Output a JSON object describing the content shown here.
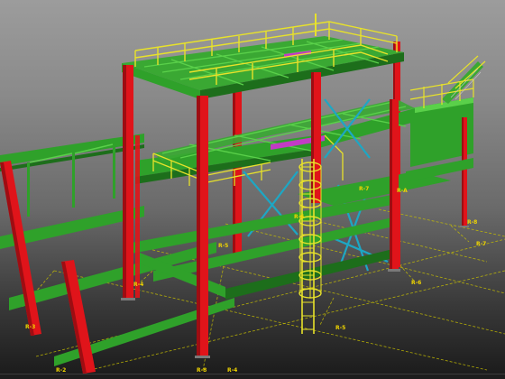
{
  "viewport": {
    "background": {
      "top": "#9c9c9c",
      "bottom": "#1a1a1a"
    }
  },
  "colors": {
    "column": "#e0141a",
    "column_dark": "#9e0d12",
    "beam": "#2fa12a",
    "beam_light": "#5ad04a",
    "handrail": "#e8e22a",
    "handrail_dark": "#b5ac12",
    "bracing": "#1da7c4",
    "grid_line": "#c8c000",
    "grid_label": "#f0d500",
    "deck_accent": "#c23bc4"
  },
  "icons": {
    "ladder": "ladder-icon",
    "stair": "stair-icon"
  },
  "grid_labels": [
    {
      "id": "r-a",
      "text": "R-A"
    },
    {
      "id": "r-7a",
      "text": "R-7"
    },
    {
      "id": "r-8a",
      "text": "R-8"
    },
    {
      "id": "r-7b",
      "text": "R-7"
    },
    {
      "id": "r-6a",
      "text": "R-6"
    },
    {
      "id": "r-5a",
      "text": "R-5"
    },
    {
      "id": "r-6b",
      "text": "R-6"
    },
    {
      "id": "r-4a",
      "text": "R-4"
    },
    {
      "id": "r-5b",
      "text": "R-5"
    },
    {
      "id": "r-3",
      "text": "R-3"
    },
    {
      "id": "r-2",
      "text": "R-2"
    },
    {
      "id": "r-8b",
      "text": "R-8"
    },
    {
      "id": "r-4b",
      "text": "R-4"
    }
  ]
}
